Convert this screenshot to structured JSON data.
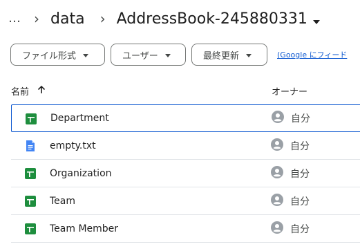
{
  "breadcrumb": {
    "more": "…",
    "separator": "›",
    "parent": "data",
    "current": "AddressBook-245880331"
  },
  "filters": {
    "file_type": "ファイル形式",
    "user": "ユーザー",
    "modified": "最終更新",
    "link": "(Google にフィード"
  },
  "list_header": {
    "name": "名前",
    "owner": "オーナー"
  },
  "files": [
    {
      "name": "Department",
      "type": "sheet",
      "owner": "自分",
      "selected": true
    },
    {
      "name": "empty.txt",
      "type": "doc",
      "owner": "自分",
      "selected": false
    },
    {
      "name": "Organization",
      "type": "sheet",
      "owner": "自分",
      "selected": false
    },
    {
      "name": "Team",
      "type": "sheet",
      "owner": "自分",
      "selected": false
    },
    {
      "name": "Team Member",
      "type": "sheet",
      "owner": "自分",
      "selected": false
    }
  ],
  "colors": {
    "sheet_icon": "#1e8e3e",
    "doc_icon": "#4285f4",
    "selection_border": "#0b57d0",
    "avatar": "#9aa0a6"
  }
}
